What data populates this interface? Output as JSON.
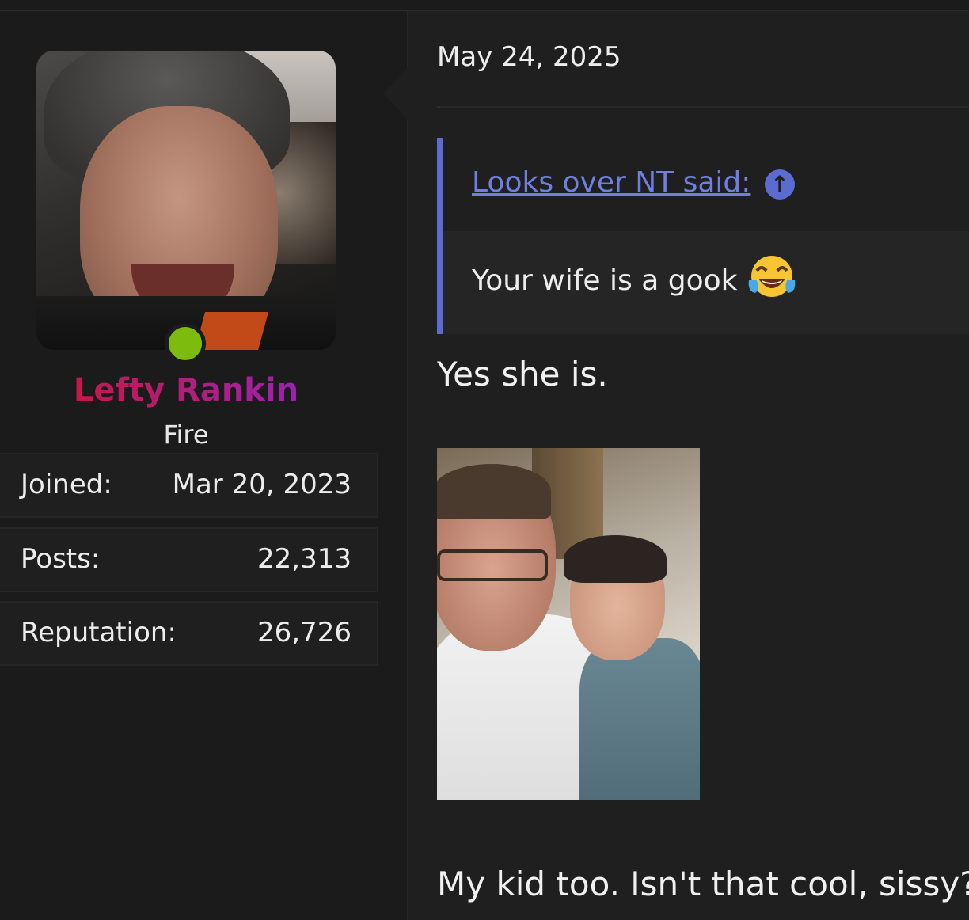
{
  "user": {
    "name": "Lefty Rankin",
    "title": "Fire",
    "status": "online",
    "name_gradient": [
      "#d6102a",
      "#b01f7a",
      "#8f22d8"
    ]
  },
  "stats": [
    {
      "label": "Joined:",
      "value": "Mar 20, 2023"
    },
    {
      "label": "Posts:",
      "value": "22,313"
    },
    {
      "label": "Reputation:",
      "value": "26,726"
    }
  ],
  "post": {
    "date": "May 24, 2025",
    "quote": {
      "author_link": "Looks over NT said:",
      "text": "Your wife is a gook",
      "emoji": "face-with-tears-of-joy",
      "accent": "#5b6bd0"
    },
    "message_1": "Yes she is.",
    "message_2": "My kid too. Isn't that cool, sissy?"
  },
  "colors": {
    "background": "#1b1b1b",
    "panel": "#1f1f1f",
    "online": "#7dbb0f",
    "link": "#6f7fe0"
  }
}
